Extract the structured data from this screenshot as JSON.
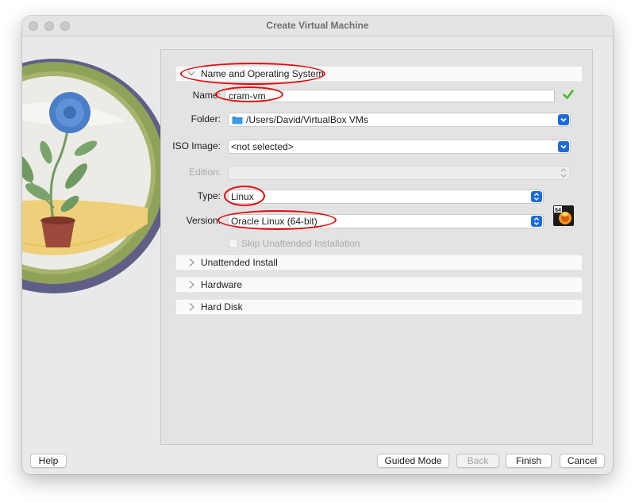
{
  "window": {
    "title": "Create Virtual Machine"
  },
  "sections": {
    "name_os": {
      "label": "Name and Operating System",
      "expanded": true
    },
    "unattended": {
      "label": "Unattended Install",
      "expanded": false
    },
    "hardware": {
      "label": "Hardware",
      "expanded": false
    },
    "hard_disk": {
      "label": "Hard Disk",
      "expanded": false
    }
  },
  "form": {
    "name": {
      "label": "Name:",
      "value": "cram-vm",
      "valid": true
    },
    "folder": {
      "label": "Folder:",
      "value": "/Users/David/VirtualBox VMs"
    },
    "iso": {
      "label": "ISO Image:",
      "value": "<not selected>"
    },
    "edition": {
      "label": "Edition:",
      "value": "",
      "disabled": true
    },
    "type": {
      "label": "Type:",
      "value": "Linux"
    },
    "version": {
      "label": "Version:",
      "value": "Oracle Linux (64-bit)"
    },
    "skip_unattended": {
      "label": "Skip Unattended Installation",
      "checked": false,
      "disabled": true
    },
    "os_badge": "64"
  },
  "buttons": {
    "help": "Help",
    "guided": "Guided Mode",
    "back": "Back",
    "finish": "Finish",
    "cancel": "Cancel"
  },
  "colors": {
    "accent_blue": "#1d6bdb",
    "annotation_red": "#e30c0c",
    "valid_green": "#3cbf1f"
  }
}
